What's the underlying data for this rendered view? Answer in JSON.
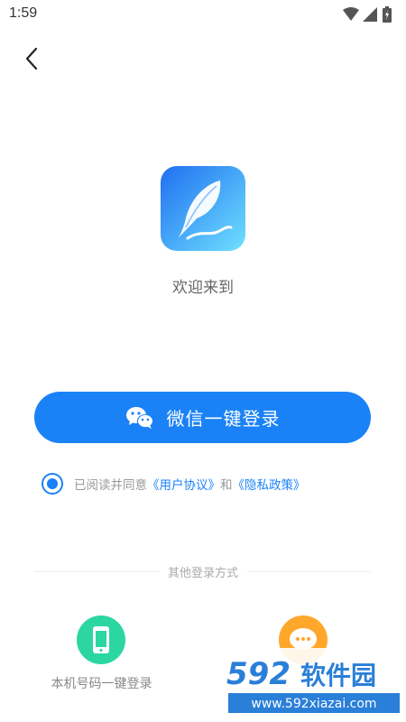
{
  "status_bar": {
    "time": "1:59"
  },
  "welcome_text": "欢迎来到",
  "wechat_login_label": "微信一键登录",
  "agreement": {
    "prefix": "已阅读并同意",
    "user_agreement": "《用户协议》",
    "and": "和",
    "privacy_policy": "《隐私政策》"
  },
  "other_login_title": "其他登录方式",
  "phone_login_label": "本机号码一键登录",
  "watermark": {
    "brand_num": "592",
    "brand_cn": "软件园",
    "url": "www.592xiazai.com"
  },
  "colors": {
    "primary": "#1a82f6",
    "phone_green": "#2cd6a1",
    "other_orange": "#ffa72a"
  }
}
